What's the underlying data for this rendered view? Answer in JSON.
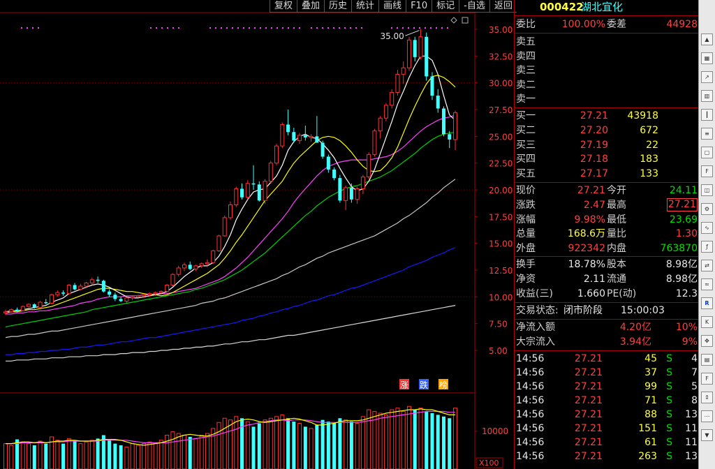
{
  "toolbar": [
    "复权",
    "叠加",
    "历史",
    "统计",
    "画线",
    "F10",
    "标记",
    "-自选",
    "返回"
  ],
  "stock": {
    "code": "000422",
    "name": "湖北宜化"
  },
  "weibi": {
    "label": "委比",
    "value": "100.00%",
    "diff_label": "委差",
    "diff_value": "44928"
  },
  "sell": [
    {
      "label": "卖五"
    },
    {
      "label": "卖四"
    },
    {
      "label": "卖三"
    },
    {
      "label": "卖二"
    },
    {
      "label": "卖一"
    }
  ],
  "buy": [
    {
      "label": "买一",
      "price": "27.21",
      "vol": "43918"
    },
    {
      "label": "买二",
      "price": "27.20",
      "vol": "672"
    },
    {
      "label": "买三",
      "price": "27.19",
      "vol": "22"
    },
    {
      "label": "买四",
      "price": "27.18",
      "vol": "183"
    },
    {
      "label": "买五",
      "price": "27.17",
      "vol": "133"
    }
  ],
  "quote": [
    {
      "l1": "现价",
      "v1": "27.21",
      "c1": "red",
      "l2": "今开",
      "v2": "24.11",
      "c2": "green"
    },
    {
      "l1": "涨跌",
      "v1": "2.47",
      "c1": "red",
      "l2": "最高",
      "v2": "27.21",
      "c2": "red"
    },
    {
      "l1": "涨幅",
      "v1": "9.98%",
      "c1": "red",
      "l2": "最低",
      "v2": "23.69",
      "c2": "green"
    },
    {
      "l1": "总量",
      "v1": "168.6万",
      "c1": "yellow",
      "l2": "量比",
      "v2": "1.30",
      "c2": "red"
    },
    {
      "l1": "外盘",
      "v1": "922342",
      "c1": "red",
      "l2": "内盘",
      "v2": "763870",
      "c2": "green"
    }
  ],
  "stats": [
    {
      "l1": "换手",
      "v1": "18.78%",
      "l2": "股本",
      "v2": "8.98亿"
    },
    {
      "l1": "净资",
      "v1": "2.11",
      "l2": "流通",
      "v2": "8.98亿"
    },
    {
      "l1": "收益(三)",
      "v1": "1.660",
      "l2": "PE(动)",
      "v2": "12.3"
    }
  ],
  "trade_status": {
    "label": "交易状态:",
    "status": "闭市阶段",
    "time": "15:00:03"
  },
  "flows": [
    {
      "label": "净流入额",
      "value": "4.20亿",
      "pct": "10%"
    },
    {
      "label": "大宗流入",
      "value": "3.94亿",
      "pct": "9%"
    }
  ],
  "ticks": [
    {
      "t": "14:56",
      "p": "27.21",
      "v": "45",
      "s": "S",
      "n": "4"
    },
    {
      "t": "14:56",
      "p": "27.21",
      "v": "37",
      "s": "S",
      "n": "7"
    },
    {
      "t": "14:56",
      "p": "27.21",
      "v": "99",
      "s": "S",
      "n": "5"
    },
    {
      "t": "14:56",
      "p": "27.21",
      "v": "71",
      "s": "S",
      "n": "8"
    },
    {
      "t": "14:56",
      "p": "27.21",
      "v": "88",
      "s": "S",
      "n": "13"
    },
    {
      "t": "14:56",
      "p": "27.21",
      "v": "151",
      "s": "S",
      "n": "11"
    },
    {
      "t": "14:56",
      "p": "27.21",
      "v": "61",
      "s": "S",
      "n": "11"
    },
    {
      "t": "14:56",
      "p": "27.21",
      "v": "263",
      "s": "S",
      "n": "13"
    }
  ],
  "chart_data": {
    "type": "candlestick",
    "y_ticks": [
      "35.00",
      "32.50",
      "30.00",
      "27.50",
      "25.00",
      "22.50",
      "20.00",
      "17.50",
      "15.00",
      "12.50",
      "10.00",
      "7.50",
      "5.00"
    ],
    "y_min": 2.5,
    "y_max": 36.0,
    "max_annotation": "35.00",
    "legend_tags": [
      "涨",
      "跌",
      "榜"
    ],
    "volume_tick": "10000",
    "volume_unit": "X100",
    "colors": {
      "up": "#ff3030",
      "down": "#40ffff",
      "ma5": "#ffffff",
      "ma10": "#ffff00",
      "ma20": "#ff40ff",
      "ma30": "#00d000",
      "ma60": "#c8c8c8",
      "ma120": "#1818ff",
      "ma250": "#d8d8d8"
    },
    "candles": [
      [
        8.5,
        8.8,
        8.3,
        8.6
      ],
      [
        8.6,
        8.9,
        8.5,
        8.8
      ],
      [
        8.8,
        9.0,
        8.6,
        8.7
      ],
      [
        8.7,
        9.2,
        8.7,
        9.1
      ],
      [
        9.1,
        9.4,
        9.0,
        9.3
      ],
      [
        9.3,
        9.4,
        8.9,
        9.0
      ],
      [
        9.0,
        9.6,
        9.0,
        9.5
      ],
      [
        9.5,
        9.8,
        9.3,
        9.4
      ],
      [
        9.4,
        10.3,
        9.3,
        10.2
      ],
      [
        10.2,
        10.6,
        10.0,
        10.4
      ],
      [
        10.4,
        10.6,
        10.1,
        10.3
      ],
      [
        10.3,
        11.2,
        10.2,
        11.1
      ],
      [
        11.1,
        11.3,
        10.6,
        10.7
      ],
      [
        10.7,
        11.2,
        10.6,
        11.0
      ],
      [
        11.0,
        11.4,
        10.8,
        11.3
      ],
      [
        11.3,
        11.8,
        11.1,
        11.6
      ],
      [
        11.6,
        11.9,
        11.3,
        11.5
      ],
      [
        11.5,
        11.6,
        10.4,
        10.5
      ],
      [
        10.5,
        10.7,
        10.0,
        10.2
      ],
      [
        10.2,
        10.4,
        9.6,
        9.8
      ],
      [
        9.8,
        10.0,
        9.5,
        9.6
      ],
      [
        9.6,
        10.0,
        9.4,
        9.9
      ],
      [
        9.9,
        10.1,
        9.7,
        10.0
      ],
      [
        10.0,
        10.2,
        9.8,
        10.1
      ],
      [
        10.1,
        10.3,
        9.9,
        10.2
      ],
      [
        10.2,
        10.4,
        10.0,
        10.3
      ],
      [
        10.3,
        10.5,
        10.1,
        10.4
      ],
      [
        10.4,
        10.6,
        10.2,
        10.5
      ],
      [
        10.5,
        11.2,
        10.4,
        11.1
      ],
      [
        11.1,
        12.2,
        11.0,
        12.1
      ],
      [
        12.1,
        12.9,
        11.9,
        12.7
      ],
      [
        12.7,
        13.2,
        12.4,
        13.0
      ],
      [
        13.0,
        13.3,
        12.5,
        12.6
      ],
      [
        12.6,
        13.0,
        12.4,
        12.9
      ],
      [
        12.9,
        13.2,
        12.7,
        13.1
      ],
      [
        13.1,
        13.5,
        12.8,
        13.2
      ],
      [
        13.2,
        14.4,
        13.1,
        14.3
      ],
      [
        14.3,
        15.8,
        14.2,
        15.7
      ],
      [
        15.7,
        17.6,
        15.6,
        17.4
      ],
      [
        17.4,
        18.9,
        17.2,
        18.6
      ],
      [
        18.6,
        20.3,
        18.4,
        20.1
      ],
      [
        20.1,
        20.6,
        19.1,
        19.3
      ],
      [
        19.3,
        20.9,
        19.1,
        20.6
      ],
      [
        20.6,
        22.3,
        20.0,
        20.5
      ],
      [
        20.5,
        20.8,
        18.9,
        19.0
      ],
      [
        19.0,
        21.0,
        18.7,
        20.8
      ],
      [
        20.8,
        22.7,
        20.6,
        22.5
      ],
      [
        22.5,
        24.3,
        22.3,
        24.1
      ],
      [
        24.1,
        26.3,
        23.9,
        26.1
      ],
      [
        26.1,
        27.5,
        25.1,
        25.4
      ],
      [
        25.4,
        25.8,
        24.4,
        24.6
      ],
      [
        24.6,
        25.3,
        24.3,
        25.1
      ],
      [
        25.1,
        26.0,
        24.6,
        24.9
      ],
      [
        24.9,
        25.2,
        24.5,
        25.0
      ],
      [
        25.0,
        26.9,
        24.8,
        24.4
      ],
      [
        24.4,
        24.6,
        22.9,
        23.1
      ],
      [
        23.1,
        23.3,
        21.6,
        21.9
      ],
      [
        21.9,
        22.1,
        20.9,
        21.1
      ],
      [
        21.1,
        21.4,
        18.8,
        19.0
      ],
      [
        19.0,
        20.4,
        18.1,
        20.2
      ],
      [
        20.2,
        20.6,
        18.8,
        19.1
      ],
      [
        19.1,
        20.3,
        18.7,
        20.1
      ],
      [
        20.1,
        21.4,
        19.6,
        21.2
      ],
      [
        21.2,
        23.5,
        21.0,
        23.3
      ],
      [
        23.3,
        25.7,
        23.1,
        25.5
      ],
      [
        25.5,
        26.9,
        24.8,
        26.7
      ],
      [
        26.7,
        28.1,
        26.4,
        27.9
      ],
      [
        27.9,
        29.4,
        27.6,
        29.1
      ],
      [
        29.1,
        31.2,
        28.8,
        30.8
      ],
      [
        30.8,
        32.0,
        29.9,
        31.4
      ],
      [
        31.4,
        34.3,
        31.1,
        34.0
      ],
      [
        34.0,
        34.3,
        32.0,
        32.4
      ],
      [
        32.4,
        35.0,
        32.2,
        34.3
      ],
      [
        34.3,
        34.7,
        30.2,
        30.6
      ],
      [
        30.6,
        31.0,
        28.4,
        28.8
      ],
      [
        28.8,
        29.4,
        27.2,
        27.6
      ],
      [
        27.6,
        27.8,
        25.0,
        25.2
      ],
      [
        25.2,
        25.5,
        23.9,
        24.7
      ],
      [
        24.7,
        27.4,
        23.7,
        27.2
      ]
    ],
    "ma5": [
      8.6,
      8.7,
      8.7,
      8.8,
      8.9,
      9.0,
      9.1,
      9.2,
      9.5,
      9.7,
      9.9,
      10.3,
      10.5,
      10.7,
      10.9,
      11.1,
      11.2,
      11.1,
      10.9,
      10.6,
      10.3,
      10.0,
      9.9,
      9.9,
      10.0,
      10.1,
      10.2,
      10.3,
      10.5,
      10.9,
      11.4,
      11.9,
      12.3,
      12.7,
      12.9,
      12.9,
      13.2,
      13.8,
      14.7,
      15.8,
      17.2,
      18.2,
      19.1,
      19.8,
      20.0,
      20.1,
      20.7,
      21.3,
      22.3,
      23.7,
      24.5,
      25.0,
      25.2,
      24.9,
      24.8,
      24.3,
      23.7,
      23.0,
      22.0,
      21.1,
      20.3,
      19.9,
      20.1,
      20.8,
      21.9,
      23.4,
      24.9,
      26.4,
      28.0,
      29.2,
      30.5,
      31.6,
      32.5,
      32.5,
      32.1,
      30.8,
      28.8,
      27.0,
      26.5
    ],
    "ma10": [
      8.5,
      8.6,
      8.6,
      8.7,
      8.8,
      8.8,
      8.9,
      9.0,
      9.1,
      9.3,
      9.5,
      9.7,
      9.9,
      10.1,
      10.3,
      10.5,
      10.7,
      10.8,
      10.8,
      10.7,
      10.6,
      10.5,
      10.5,
      10.4,
      10.3,
      10.2,
      10.2,
      10.1,
      10.2,
      10.4,
      10.7,
      11.0,
      11.3,
      11.6,
      11.9,
      12.2,
      12.6,
      13.0,
      13.6,
      14.3,
      15.1,
      15.8,
      16.6,
      17.4,
      18.2,
      19.0,
      19.6,
      20.2,
      20.8,
      21.7,
      22.5,
      23.1,
      23.6,
      24.1,
      24.6,
      24.9,
      25.0,
      24.9,
      24.6,
      24.1,
      23.5,
      22.8,
      22.2,
      21.8,
      21.7,
      21.8,
      22.3,
      23.0,
      24.0,
      25.3,
      26.6,
      27.8,
      28.9,
      29.9,
      30.6,
      30.7,
      30.5,
      30.1,
      29.6
    ],
    "ma20": [
      8.4,
      8.4,
      8.5,
      8.5,
      8.6,
      8.6,
      8.7,
      8.7,
      8.8,
      8.9,
      9.0,
      9.1,
      9.2,
      9.4,
      9.5,
      9.6,
      9.8,
      9.9,
      10.0,
      10.0,
      10.0,
      10.1,
      10.1,
      10.1,
      10.2,
      10.2,
      10.3,
      10.3,
      10.3,
      10.4,
      10.5,
      10.6,
      10.7,
      10.8,
      11.0,
      11.2,
      11.4,
      11.6,
      11.9,
      12.3,
      12.7,
      13.2,
      13.7,
      14.3,
      14.9,
      15.5,
      16.1,
      16.7,
      17.3,
      18.0,
      18.8,
      19.5,
      20.1,
      20.7,
      21.3,
      21.8,
      22.2,
      22.4,
      22.6,
      22.7,
      22.8,
      22.8,
      22.8,
      22.8,
      22.9,
      23.0,
      23.1,
      23.3,
      23.6,
      24.0,
      24.5,
      25.0,
      25.5,
      25.9,
      26.2,
      26.5,
      26.7,
      26.8,
      27.0
    ],
    "ma30": [
      7.2,
      7.3,
      7.4,
      7.5,
      7.6,
      7.7,
      7.8,
      7.9,
      8.0,
      8.1,
      8.2,
      8.3,
      8.4,
      8.5,
      8.6,
      8.8,
      8.9,
      9.0,
      9.1,
      9.2,
      9.3,
      9.4,
      9.5,
      9.6,
      9.7,
      9.8,
      9.9,
      10.0,
      10.1,
      10.2,
      10.3,
      10.4,
      10.5,
      10.7,
      10.8,
      11.0,
      11.2,
      11.4,
      11.6,
      11.9,
      12.2,
      12.5,
      12.9,
      13.3,
      13.7,
      14.1,
      14.6,
      15.1,
      15.6,
      16.1,
      16.6,
      17.1,
      17.6,
      18.0,
      18.5,
      18.9,
      19.3,
      19.6,
      19.9,
      20.1,
      20.3,
      20.4,
      20.6,
      20.8,
      21.0,
      21.2,
      21.5,
      21.8,
      22.2,
      22.6,
      23.0,
      23.4,
      23.9,
      24.3,
      24.7,
      25.0,
      25.2,
      25.3,
      25.4
    ],
    "ma60": [
      6.2,
      6.3,
      6.3,
      6.4,
      6.5,
      6.5,
      6.6,
      6.7,
      6.8,
      6.8,
      6.9,
      7.0,
      7.1,
      7.2,
      7.3,
      7.4,
      7.5,
      7.6,
      7.7,
      7.8,
      7.9,
      8.0,
      8.1,
      8.2,
      8.3,
      8.4,
      8.5,
      8.6,
      8.7,
      8.8,
      8.9,
      9.0,
      9.1,
      9.2,
      9.4,
      9.5,
      9.6,
      9.8,
      9.9,
      10.1,
      10.3,
      10.5,
      10.7,
      10.9,
      11.1,
      11.3,
      11.5,
      11.7,
      12.0,
      12.2,
      12.5,
      12.8,
      13.0,
      13.3,
      13.6,
      13.8,
      14.1,
      14.3,
      14.5,
      14.7,
      14.9,
      15.1,
      15.3,
      15.5,
      15.7,
      16.0,
      16.3,
      16.6,
      16.9,
      17.3,
      17.6,
      18.0,
      18.4,
      18.8,
      19.3,
      19.7,
      20.2,
      20.6,
      21.0
    ],
    "ma120": [
      4.6,
      4.6,
      4.7,
      4.7,
      4.8,
      4.8,
      4.9,
      4.9,
      5.0,
      5.0,
      5.1,
      5.1,
      5.2,
      5.3,
      5.3,
      5.4,
      5.5,
      5.5,
      5.6,
      5.7,
      5.8,
      5.8,
      5.9,
      6.0,
      6.1,
      6.2,
      6.2,
      6.3,
      6.4,
      6.5,
      6.6,
      6.7,
      6.8,
      6.9,
      7.0,
      7.1,
      7.2,
      7.3,
      7.4,
      7.5,
      7.6,
      7.8,
      7.9,
      8.0,
      8.2,
      8.3,
      8.5,
      8.6,
      8.8,
      8.9,
      9.1,
      9.2,
      9.4,
      9.6,
      9.7,
      9.9,
      10.1,
      10.2,
      10.4,
      10.6,
      10.8,
      10.9,
      11.1,
      11.3,
      11.5,
      11.7,
      11.9,
      12.1,
      12.3,
      12.5,
      12.8,
      13.0,
      13.2,
      13.4,
      13.7,
      13.9,
      14.1,
      14.4,
      14.6
    ],
    "ma250": [
      4.0,
      4.0,
      4.1,
      4.1,
      4.1,
      4.2,
      4.2,
      4.2,
      4.3,
      4.3,
      4.3,
      4.4,
      4.4,
      4.4,
      4.5,
      4.5,
      4.5,
      4.6,
      4.6,
      4.6,
      4.7,
      4.7,
      4.8,
      4.8,
      4.8,
      4.9,
      4.9,
      5.0,
      5.0,
      5.1,
      5.1,
      5.2,
      5.2,
      5.3,
      5.3,
      5.4,
      5.4,
      5.5,
      5.6,
      5.6,
      5.7,
      5.8,
      5.8,
      5.9,
      6.0,
      6.0,
      6.1,
      6.2,
      6.3,
      6.4,
      6.4,
      6.5,
      6.6,
      6.7,
      6.8,
      6.9,
      7.0,
      7.1,
      7.2,
      7.3,
      7.4,
      7.5,
      7.6,
      7.7,
      7.8,
      7.9,
      8.0,
      8.1,
      8.2,
      8.3,
      8.4,
      8.5,
      8.6,
      8.7,
      8.8,
      8.9,
      9.0,
      9.1,
      9.2
    ],
    "volume": [
      30,
      28,
      35,
      32,
      30,
      28,
      33,
      30,
      38,
      34,
      30,
      36,
      34,
      30,
      32,
      34,
      36,
      40,
      34,
      30,
      28,
      26,
      30,
      28,
      30,
      32,
      30,
      34,
      40,
      44,
      42,
      40,
      38,
      36,
      40,
      42,
      48,
      55,
      60,
      58,
      62,
      60,
      56,
      50,
      54,
      58,
      60,
      62,
      64,
      60,
      56,
      54,
      50,
      48,
      52,
      58,
      56,
      54,
      60,
      58,
      56,
      54,
      62,
      70,
      68,
      66,
      64,
      70,
      72,
      68,
      74,
      70,
      72,
      68,
      66,
      64,
      62,
      60,
      72
    ],
    "vol_ma5": [
      30,
      30,
      31,
      32,
      32,
      31,
      32,
      31,
      32,
      33,
      33,
      34,
      34,
      33,
      33,
      33,
      34,
      35,
      35,
      35,
      34,
      32,
      30,
      29,
      28,
      29,
      30,
      31,
      33,
      35,
      38,
      40,
      41,
      40,
      39,
      39,
      41,
      44,
      48,
      52,
      56,
      58,
      59,
      58,
      56,
      55,
      56,
      57,
      58,
      59,
      60,
      59,
      57,
      55,
      52,
      52,
      53,
      54,
      56,
      57,
      57,
      57,
      58,
      60,
      62,
      64,
      66,
      67,
      68,
      69,
      70,
      70,
      71,
      70,
      70,
      68,
      66,
      64,
      64
    ],
    "vol_ma10": [
      30,
      30,
      30,
      31,
      31,
      31,
      31,
      31,
      32,
      32,
      32,
      33,
      33,
      33,
      33,
      33,
      33,
      34,
      34,
      34,
      34,
      34,
      33,
      32,
      31,
      31,
      31,
      31,
      31,
      32,
      33,
      34,
      35,
      36,
      37,
      38,
      39,
      41,
      43,
      45,
      47,
      50,
      52,
      53,
      55,
      56,
      57,
      58,
      58,
      57,
      58,
      58,
      58,
      57,
      56,
      55,
      55,
      55,
      55,
      55,
      55,
      55,
      56,
      57,
      58,
      60,
      61,
      62,
      63,
      64,
      65,
      66,
      67,
      68,
      68,
      68,
      68,
      67,
      67
    ]
  }
}
